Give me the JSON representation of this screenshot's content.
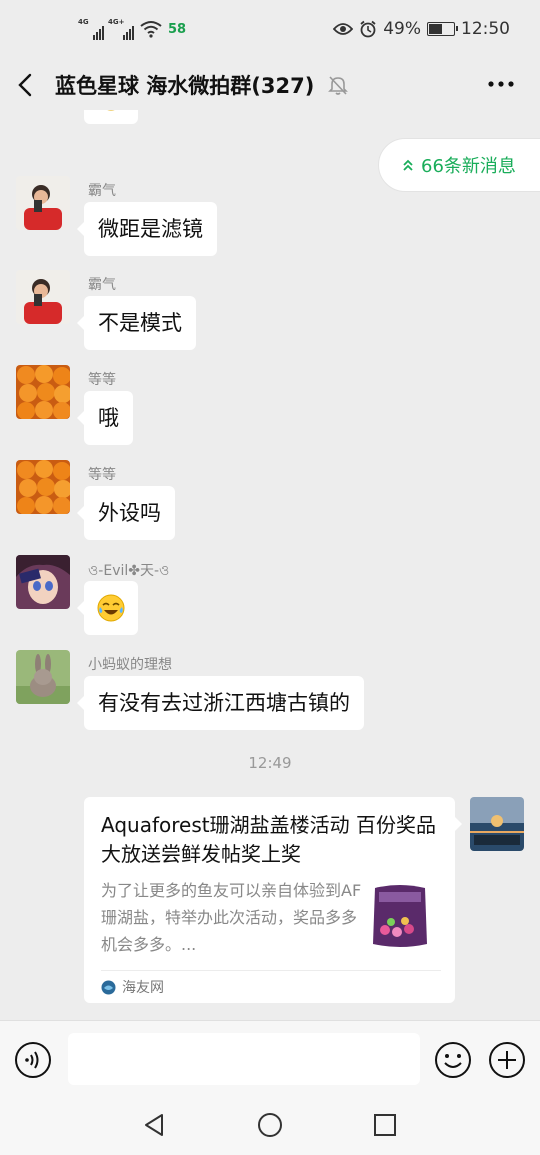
{
  "status_bar": {
    "signal1_label": "4G",
    "signal2_label": "4G+",
    "badge": "58",
    "battery": "49%",
    "battery_level": 0.49,
    "time": "12:50",
    "icons": [
      "signal-icon",
      "wifi-icon",
      "eye-icon",
      "alarm-icon",
      "battery-icon"
    ]
  },
  "header": {
    "title": "蓝色星球 海水微拍群(327)",
    "icons": [
      "back-icon",
      "mute-bell-icon",
      "more-icon"
    ]
  },
  "new_messages": {
    "label": "66条新消息",
    "icon": "double-chevron-up-icon",
    "color": "#1aad5a"
  },
  "messages": [
    {
      "sender": "",
      "type": "emoji",
      "emoji": "sweat-smile-emoji"
    },
    {
      "sender": "霸气",
      "type": "text",
      "text": "微距是滤镜"
    },
    {
      "sender": "霸气",
      "type": "text",
      "text": "不是模式"
    },
    {
      "sender": "等等",
      "type": "text",
      "text": "哦"
    },
    {
      "sender": "等等",
      "type": "text",
      "text": "外设吗"
    },
    {
      "sender": "ও-Evil✤天-ও",
      "type": "emoji",
      "emoji": "tears-of-joy-emoji"
    },
    {
      "sender": "小蚂蚁的理想",
      "type": "text",
      "text": "有没有去过浙江西塘古镇的"
    }
  ],
  "timestamp": "12:49",
  "link_card": {
    "title": "Aquaforest珊湖盐盖楼活动 百份奖品大放送尝鲜发帖奖上奖",
    "description": "为了让更多的鱼友可以亲自体验到AF珊湖盐，特举办此次活动，奖品多多机会多多。...",
    "source": "海友网"
  },
  "input_bar": {
    "placeholder": "",
    "icons": [
      "voice-icon",
      "emoji-icon",
      "plus-icon"
    ]
  },
  "nav_bar": {
    "icons": [
      "nav-back-icon",
      "nav-home-icon",
      "nav-recent-icon"
    ]
  },
  "colors": {
    "background": "#ededed",
    "bubble": "#ffffff",
    "accent_green": "#1aad5a"
  }
}
